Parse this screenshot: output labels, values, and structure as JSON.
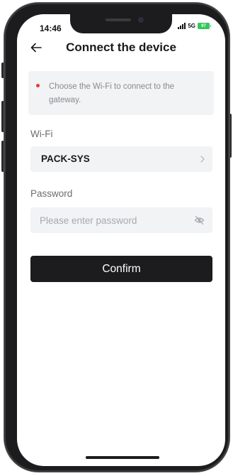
{
  "status_bar": {
    "time": "14:46",
    "network": "5G",
    "battery": "97"
  },
  "header": {
    "title": "Connect the device",
    "back_icon": "arrow-left-icon"
  },
  "notice": {
    "text": "Choose the Wi-Fi to connect to the gateway.",
    "dot_color": "#e53935"
  },
  "wifi": {
    "label": "Wi-Fi",
    "selected_network": "PACK-SYS",
    "chevron_icon": "chevron-right-icon"
  },
  "password": {
    "label": "Password",
    "placeholder": "Please enter password",
    "value": "",
    "visibility_icon": "eye-off-icon"
  },
  "actions": {
    "confirm_label": "Confirm"
  },
  "colors": {
    "accent_dark": "#1c1c1e",
    "field_background": "#f2f3f5",
    "battery_green": "#34c759"
  }
}
